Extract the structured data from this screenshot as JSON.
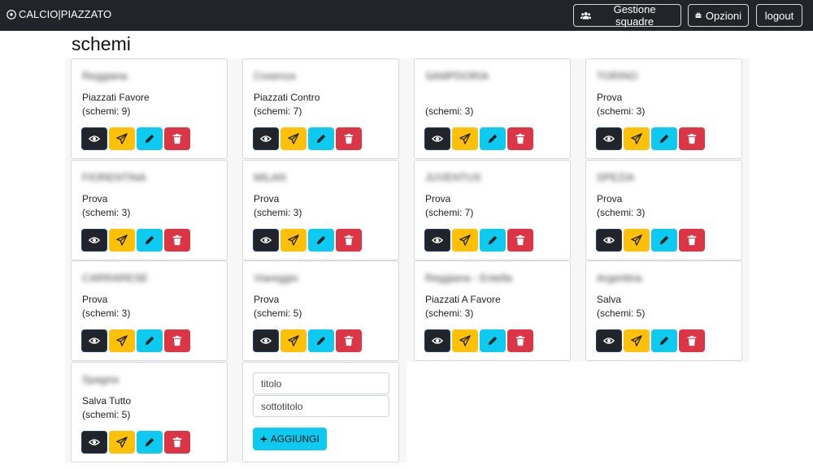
{
  "nav": {
    "brand": "CALCIO|PIAZZATO",
    "manage_label": "Gestione squadre",
    "options_label": "Opzioni",
    "logout_label": "logout"
  },
  "page": {
    "title": "schemi"
  },
  "cards": [
    {
      "team": "Reggiana",
      "subtitle": "Piazzati Favore",
      "count": "(schemi: 9)"
    },
    {
      "team": "Cosenza",
      "subtitle": "Piazzati Contro",
      "count": "(schemi: 7)"
    },
    {
      "team": "SAMPDORIA",
      "subtitle": "",
      "count": "(schemi: 3)"
    },
    {
      "team": "TORINO",
      "subtitle": "Prova",
      "count": "(schemi: 3)"
    },
    {
      "team": "FIORENTINA",
      "subtitle": "Prova",
      "count": "(schemi: 3)"
    },
    {
      "team": "MILAN",
      "subtitle": "Prova",
      "count": "(schemi: 3)"
    },
    {
      "team": "JUVENTUS",
      "subtitle": "Prova",
      "count": "(schemi: 7)"
    },
    {
      "team": "SPEZIA",
      "subtitle": "Prova",
      "count": "(schemi: 3)"
    },
    {
      "team": "CARRARESE",
      "subtitle": "Prova",
      "count": "(schemi: 3)"
    },
    {
      "team": "Viareggio",
      "subtitle": "Prova",
      "count": "(schemi: 5)"
    },
    {
      "team": "Reggiana - Entella",
      "subtitle": "Piazzati A Favore",
      "count": "(schemi: 3)"
    },
    {
      "team": "Argentina",
      "subtitle": "Salva",
      "count": "(schemi: 5)"
    },
    {
      "team": "Spagna",
      "subtitle": "Salva Tutto",
      "count": "(schemi: 5)"
    }
  ],
  "form": {
    "title_placeholder": "titolo",
    "subtitle_placeholder": "sottotitolo",
    "add_label": "AGGIUNGI"
  },
  "icons": {
    "view": "eye-icon",
    "send": "paper-plane-icon",
    "edit": "pencil-icon",
    "delete": "trash-icon",
    "brand": "soccer-ball-icon",
    "manage": "users-icon",
    "options": "toolbox-icon"
  },
  "colors": {
    "navbar": "#212529",
    "view": "#212529",
    "send": "#ffc107",
    "edit": "#0dcaf0",
    "delete": "#dc3545"
  }
}
